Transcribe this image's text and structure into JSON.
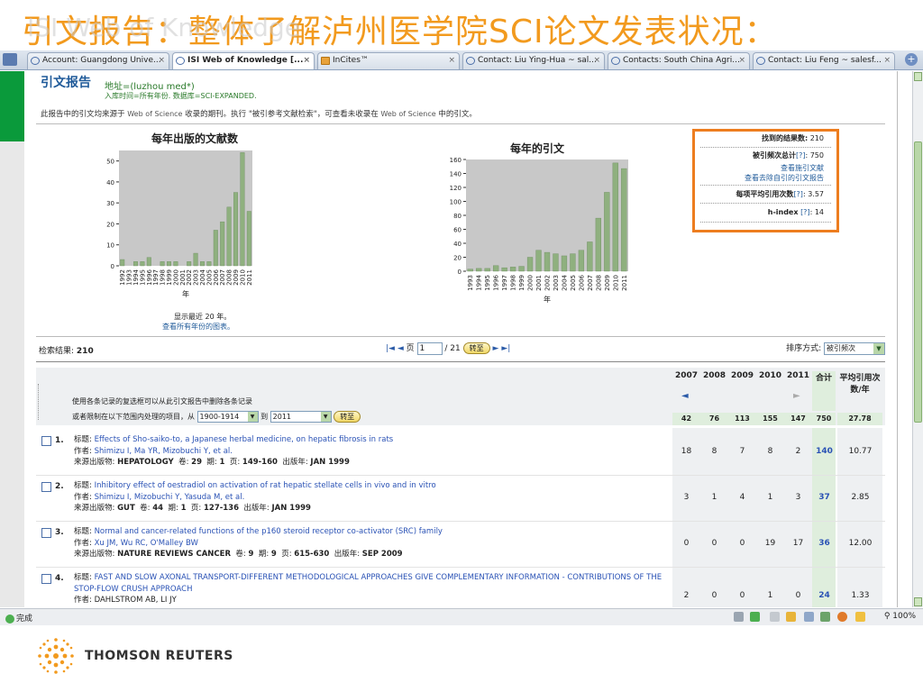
{
  "slide": {
    "title": "引文报告：整体了解泸州医学院SCI论文发表状况：",
    "ghost_title": "ISI Web of Knowledge"
  },
  "browser": {
    "tabs": [
      {
        "label": "Account: Guangdong Unive...",
        "active": false
      },
      {
        "label": "ISI Web of Knowledge [...",
        "active": true
      },
      {
        "label": "InCites™",
        "active": false
      },
      {
        "label": "Contact: Liu Ying-Hua ~ sal...",
        "active": false
      },
      {
        "label": "Contacts: South China Agri...",
        "active": false
      },
      {
        "label": "Contact: Liu Feng ~ salesf...",
        "active": false
      }
    ],
    "tab_close": "×",
    "new_tab": "+",
    "status": "完成",
    "zoom": "100%"
  },
  "report": {
    "title": "引文报告",
    "address": "地址=(luzhou med*)",
    "timespan": "入库时间=所有年份. 数据库=SCI-EXPANDED.",
    "description_a": "此报告中的引文均来源于",
    "description_src1": "Web of Science",
    "description_b": "收录的期刊。执行 \"被引参考文献检索\"，可查看未收录在",
    "description_src2": "Web of Science",
    "description_c": "中的引文。",
    "chart_note": "显示最近 20 年。",
    "chart_link": "查看所有年份的图表。"
  },
  "stats": {
    "results_label": "找到的结果数:",
    "results_value": "210",
    "times_cited_label": "被引频次总计",
    "help": "[?]",
    "times_cited_value": "750",
    "view_citing": "查看施引文献",
    "view_without_self": "查看去除自引的引文报告",
    "avg_label": "每项平均引用次数",
    "avg_value": "3.57",
    "hindex_label": "h-index",
    "hindex_value": "14"
  },
  "pager": {
    "results_label": "检索结果:",
    "results_value": "210",
    "page_label": "页",
    "page_value": "1",
    "of": "/ 21",
    "go": "转至",
    "sort_label": "排序方式:",
    "sort_value": "被引频次"
  },
  "table": {
    "hint_line1": "使用各条记录的复选框可以从此引文报告中删除各条记录",
    "hint_line2_a": "或者限制在以下范围内处理的项目，从",
    "range_from": "1900-1914",
    "range_to_label": "到",
    "range_to": "2011",
    "go": "转至",
    "prev": "◄",
    "next": "►",
    "years": [
      "2007",
      "2008",
      "2009",
      "2010",
      "2011"
    ],
    "total_label": "合计",
    "avg_label": "平均引用次数/年",
    "year_totals": [
      "42",
      "76",
      "113",
      "155",
      "147"
    ],
    "grand_total": "750",
    "grand_avg": "27.78",
    "labels": {
      "title": "标题:",
      "author": "作者:",
      "source": "来源出版物:",
      "vol": "卷:",
      "issue": "期:",
      "pages": "页:",
      "pubdate": "出版年:"
    },
    "rows": [
      {
        "n": "1.",
        "title": "Effects of Sho-saiko-to, a Japanese herbal medicine, on hepatic fibrosis in rats",
        "authors": "Shimizu I, Ma YR, Mizobuchi Y, et al.",
        "source": "HEPATOLOGY",
        "vol": "29",
        "issue": "1",
        "pages": "149-160",
        "date": "JAN 1999",
        "cites": [
          "18",
          "8",
          "7",
          "8",
          "2"
        ],
        "total": "140",
        "avg": "10.77"
      },
      {
        "n": "2.",
        "title": "Inhibitory effect of oestradiol on activation of rat hepatic stellate cells in vivo and in vitro",
        "authors": "Shimizu I, Mizobuchi Y, Yasuda M, et al.",
        "source": "GUT",
        "vol": "44",
        "issue": "1",
        "pages": "127-136",
        "date": "JAN 1999",
        "cites": [
          "3",
          "1",
          "4",
          "1",
          "3"
        ],
        "total": "37",
        "avg": "2.85"
      },
      {
        "n": "3.",
        "title": "Normal and cancer-related functions of the p160 steroid receptor co-activator (SRC) family",
        "authors": "Xu JM, Wu RC, O'Malley BW",
        "source": "NATURE REVIEWS CANCER",
        "vol": "9",
        "issue": "9",
        "pages": "615-630",
        "date": "SEP 2009",
        "cites": [
          "0",
          "0",
          "0",
          "19",
          "17"
        ],
        "total": "36",
        "avg": "12.00"
      },
      {
        "n": "4.",
        "title": "FAST AND SLOW AXONAL TRANSPORT-DIFFERENT METHODOLOGICAL APPROACHES GIVE COMPLEMENTARY INFORMATION - CONTRIBUTIONS OF THE STOP-FLOW CRUSH APPROACH",
        "authors": "DAHLSTROM AB, LI JY",
        "cites": [
          "2",
          "0",
          "0",
          "1",
          "0"
        ],
        "total": "24",
        "avg": "1.33"
      }
    ]
  },
  "footer": {
    "brand": "THOMSON REUTERS"
  },
  "chart_data": [
    {
      "type": "bar",
      "title": "每年出版的文献数",
      "xlabel": "年",
      "categories": [
        "1992",
        "1993",
        "1994",
        "1995",
        "1996",
        "1997",
        "1998",
        "1999",
        "2000",
        "2001",
        "2002",
        "2003",
        "2004",
        "2005",
        "2006",
        "2007",
        "2008",
        "2009",
        "2010",
        "2011"
      ],
      "values": [
        3,
        0,
        2,
        2,
        4,
        0,
        2,
        2,
        2,
        0,
        2,
        6,
        2,
        2,
        17,
        21,
        28,
        35,
        54,
        26
      ],
      "ylim": [
        0,
        55
      ],
      "yticks": [
        0,
        10,
        20,
        30,
        40,
        50
      ],
      "color": "#8fb07f",
      "plot_bg": "#c8c8c8"
    },
    {
      "type": "bar",
      "title": "每年的引文",
      "xlabel": "年",
      "categories": [
        "1993",
        "1994",
        "1995",
        "1996",
        "1997",
        "1998",
        "1999",
        "2000",
        "2001",
        "2002",
        "2003",
        "2004",
        "2005",
        "2006",
        "2007",
        "2008",
        "2009",
        "2010",
        "2011"
      ],
      "values": [
        3,
        4,
        4,
        8,
        5,
        6,
        7,
        20,
        30,
        27,
        25,
        22,
        25,
        30,
        42,
        76,
        113,
        155,
        147
      ],
      "ylim": [
        0,
        160
      ],
      "yticks": [
        0,
        20,
        40,
        60,
        80,
        100,
        120,
        140,
        160
      ],
      "color": "#8fb07f",
      "plot_bg": "#c8c8c8"
    }
  ]
}
